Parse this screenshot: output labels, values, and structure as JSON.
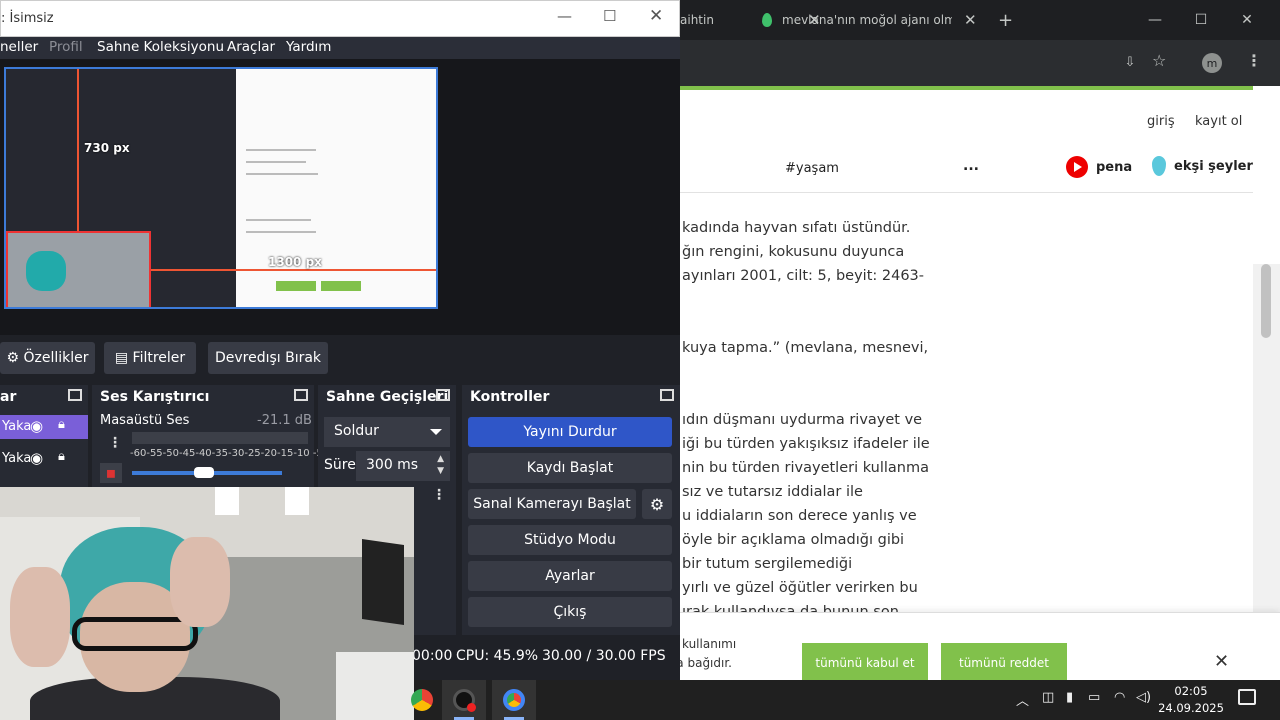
{
  "browser": {
    "tabs": [
      {
        "label": "aihtin"
      },
      {
        "label": "mevlana'nın moğol ajanı olmas"
      }
    ],
    "new_tab": "+",
    "profile_letter": "m",
    "site": {
      "giris": "giriş",
      "kayit": "kayıt ol",
      "topic": "#yaşam",
      "more": "...",
      "pena": "pena",
      "eksi": "ekşi şeyler",
      "lines": [
        "kadında hayvan sıfatı üstündür.",
        "ğın rengini, kokusunu duyunca",
        "ayınları 2001, cilt: 5, beyit: 2463-",
        "kuya tapma.” (mevlana, mesnevi,",
        "ıdın düşmanı uydurma rivayet ve",
        "iği bu türden yakışıksız ifadeler ile",
        "nin bu türden rivayetleri kullanma",
        "sız ve tutarsız iddialar ile",
        "u iddiaların son derece yanlış ve",
        "öyle bir açıklama olmadığı gibi",
        "bir tutum sergilemediği",
        "yırlı ve güzel öğütler verirken bu",
        "ırak kullandıysa da bunun son"
      ]
    },
    "cookie": {
      "text1": "kullanımı",
      "text2": "za bağıdır.",
      "accept": "tümünü kabul et",
      "reject": "tümünü reddet",
      "close": "✕"
    }
  },
  "obs": {
    "title": ": İsimsiz",
    "menu": [
      "neller",
      "Profil",
      "Sahne Koleksiyonu",
      "Araçlar",
      "Yardım"
    ],
    "preview": {
      "label_a": "730 px",
      "label_b": "1300 px"
    },
    "prop_buttons": {
      "properties": "Özellikler",
      "filters": "Filtreler",
      "disable": "Devredışı Bırak"
    },
    "docks": {
      "sources": "ar",
      "mixer": "Ses Karıştırıcı",
      "transitions": "Sahne Geçişleri",
      "controls": "Kontroller"
    },
    "sources": [
      {
        "name": "Yaka"
      },
      {
        "name": "Yaka"
      }
    ],
    "mixer": {
      "name": "Masaüstü Ses",
      "db": "-21.1 dB",
      "scale": "-60-55-50-45-40-35-30-25-20-15-10 -5  0",
      "level": 0.48
    },
    "transitions": {
      "selected": "Soldur",
      "duration_label": "Süre",
      "duration": "300 ms"
    },
    "controls": [
      "Yayını Durdur",
      "Kaydı Başlat",
      "Sanal Kamerayı Başlat",
      "Stüdyo Modu",
      "Ayarlar",
      "Çıkış"
    ],
    "status": {
      "time": "00:00",
      "cpu": "CPU: 45.9%",
      "fps": "30.00 / 30.00 FPS"
    }
  },
  "taskbar": {
    "time": "02:05",
    "date": "24.09.2025"
  },
  "colors": {
    "accent_green": "#81c14b",
    "obs_blue": "#2f56c8",
    "source_selected": "#7a5fd8"
  }
}
